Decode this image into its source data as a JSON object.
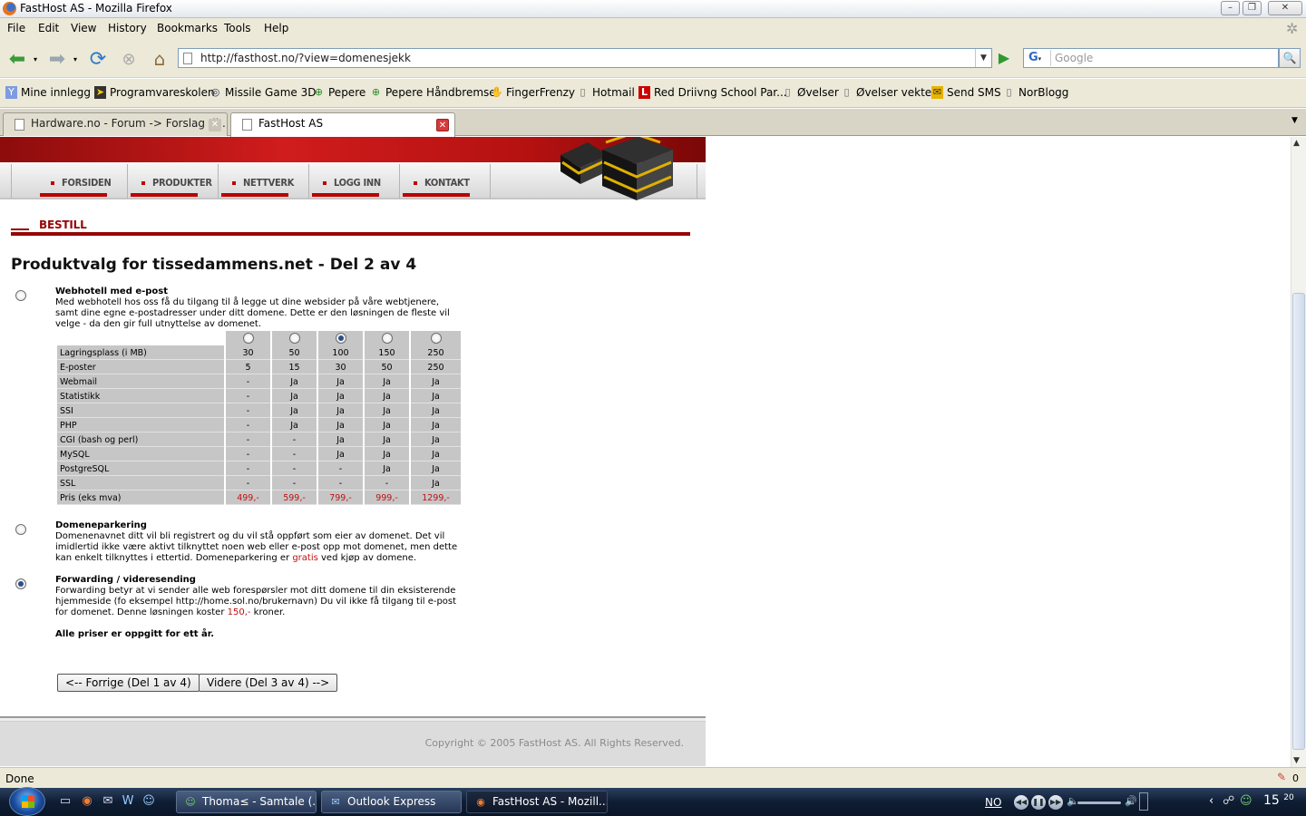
{
  "window": {
    "title": "FastHost AS - Mozilla Firefox",
    "minimize": "–",
    "maximize": "❐",
    "close": "✕"
  },
  "menu": [
    "File",
    "Edit",
    "View",
    "History",
    "Bookmarks",
    "Tools",
    "Help"
  ],
  "nav": {
    "back_icon": "back-arrow-icon",
    "forward_icon": "forward-arrow-icon",
    "url": "http://fasthost.no/?view=domenesjekk",
    "search_placeholder": "Google",
    "search_engine": "G"
  },
  "bookmarks": [
    {
      "label": "Mine innlegg",
      "icon": "Y"
    },
    {
      "label": "Programvareskolen",
      "icon": "➤"
    },
    {
      "label": "Missile Game 3D",
      "icon": "◎"
    },
    {
      "label": "Pepere",
      "icon": "⊕"
    },
    {
      "label": "Pepere Håndbremse",
      "icon": "⊕"
    },
    {
      "label": "FingerFrenzy",
      "icon": "✋"
    },
    {
      "label": "Hotmail",
      "icon": "▯"
    },
    {
      "label": "Red Driivng School Par...",
      "icon": "L"
    },
    {
      "label": "Øvelser",
      "icon": "▯"
    },
    {
      "label": "Øvelser vekter",
      "icon": "▯"
    },
    {
      "label": "Send SMS",
      "icon": "✉"
    },
    {
      "label": "NorBlogg",
      "icon": "▯"
    }
  ],
  "tabs": [
    {
      "label": "Hardware.no - Forum -> Forslag til ...",
      "active": false
    },
    {
      "label": "FastHost AS",
      "active": true
    }
  ],
  "site": {
    "nav": [
      "FORSIDEN",
      "PRODUKTER",
      "NETTVERK",
      "LOGG INN",
      "KONTAKT"
    ],
    "section": "BESTILL",
    "heading": "Produktvalg for tissedammens.net - Del 2 av 4",
    "option1": {
      "title": "Webhotell med e-post",
      "desc": "Med webhotell hos oss få du tilgang til å legge ut dine websider på våre webtjenere, samt dine egne e-postadresser under ditt domene. Dette er den løsningen de fleste vil velge - da den gir full utnyttelse av domenet.",
      "selected": false
    },
    "table": {
      "selected_plan": 2,
      "rows": [
        {
          "label": "Lagringsplass (i MB)",
          "values": [
            "30",
            "50",
            "100",
            "150",
            "250"
          ]
        },
        {
          "label": "E-poster",
          "values": [
            "5",
            "15",
            "30",
            "50",
            "250"
          ]
        },
        {
          "label": "Webmail",
          "values": [
            "-",
            "Ja",
            "Ja",
            "Ja",
            "Ja"
          ]
        },
        {
          "label": "Statistikk",
          "values": [
            "-",
            "Ja",
            "Ja",
            "Ja",
            "Ja"
          ]
        },
        {
          "label": "SSI",
          "values": [
            "-",
            "Ja",
            "Ja",
            "Ja",
            "Ja"
          ]
        },
        {
          "label": "PHP",
          "values": [
            "-",
            "Ja",
            "Ja",
            "Ja",
            "Ja"
          ]
        },
        {
          "label": "CGI (bash og perl)",
          "values": [
            "-",
            "-",
            "Ja",
            "Ja",
            "Ja"
          ]
        },
        {
          "label": "MySQL",
          "values": [
            "-",
            "-",
            "Ja",
            "Ja",
            "Ja"
          ]
        },
        {
          "label": "PostgreSQL",
          "values": [
            "-",
            "-",
            "-",
            "Ja",
            "Ja"
          ]
        },
        {
          "label": "SSL",
          "values": [
            "-",
            "-",
            "-",
            "-",
            "Ja"
          ]
        }
      ],
      "price": {
        "label": "Pris (eks mva)",
        "values": [
          "499,-",
          "599,-",
          "799,-",
          "999,-",
          "1299,-"
        ]
      }
    },
    "option2": {
      "title": "Domeneparkering",
      "desc_a": "Domenenavnet ditt vil bli registrert og du vil stå oppført som eier av domenet. Det vil imidlertid ikke være aktivt tilknyttet noen web eller e-post opp mot domenet, men dette kan enkelt tilknyttes i ettertid. Domeneparkering er ",
      "desc_red": "gratis",
      "desc_b": " ved kjøp av domene.",
      "selected": false
    },
    "option3": {
      "title": "Forwarding / videresending",
      "desc_a": "Forwarding betyr at vi sender alle web forespørsler mot ditt domene til din eksisterende hjemmeside (fo eksempel http://home.sol.no/brukernavn) Du vil ikke få tilgang til e-post for domenet. Denne løsningen koster ",
      "desc_red": "150,-",
      "desc_b": " kroner.",
      "selected": true
    },
    "note": "Alle priser er oppgitt for ett år.",
    "prev_button": "<-- Forrige (Del 1 av 4)",
    "next_button": "Videre (Del 3 av 4) -->",
    "copyright": "Copyright © 2005 FastHost AS. All Rights Reserved."
  },
  "status": {
    "text": "Done",
    "count": "0"
  },
  "taskbar": {
    "tasks": [
      {
        "label": "Thoma≤ - Samtale (...",
        "icon": "☺"
      },
      {
        "label": "Outlook Express",
        "icon": "✉"
      },
      {
        "label": "FastHost AS - Mozill...",
        "icon": "◉"
      }
    ],
    "tray_lang": "NO",
    "clock_hour": "15",
    "clock_min": "20"
  },
  "colors": {
    "brand_red": "#960606",
    "price_red": "#c01010"
  }
}
